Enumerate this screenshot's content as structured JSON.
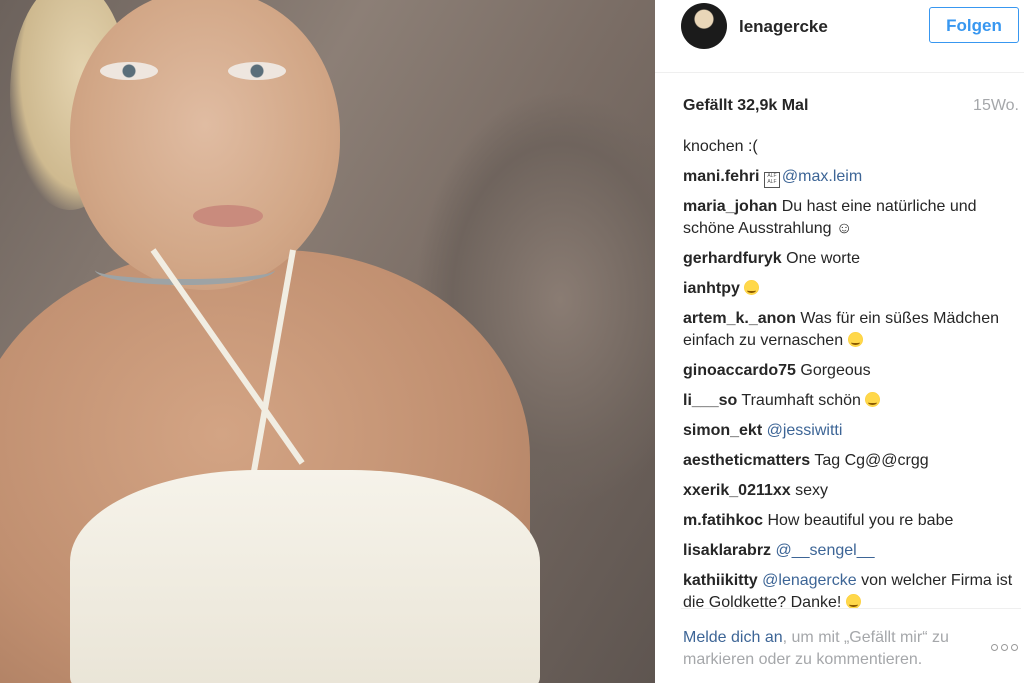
{
  "post": {
    "username": "lenagercke",
    "follow_label": "Folgen",
    "likes": "Gefällt 32,9k Mal",
    "time": "15Wo.",
    "caption": "knochen :("
  },
  "comments": [
    {
      "user": "mani.fehri",
      "text": "",
      "mention": "@max.leim",
      "tofu": "ALF ALF"
    },
    {
      "user": "maria_johan",
      "text": " Du hast eine natürliche und schöne Ausstrahlung ☺"
    },
    {
      "user": "gerhardfuryk",
      "text": " One worte"
    },
    {
      "user": "ianhtpy",
      "text": " ",
      "emoji": "heart-eyes-emoji"
    },
    {
      "user": "artem_k._anon",
      "text": " Was für ein süßes Mädchen einfach zu vernaschen ",
      "emoji": "smile-emoji"
    },
    {
      "user": "ginoaccardo75",
      "text": " Gorgeous"
    },
    {
      "user": "li___so",
      "text": " Traumhaft schön ",
      "emoji": "heart-eyes-emoji"
    },
    {
      "user": "simon_ekt",
      "text": " ",
      "mention": "@jessiwitti"
    },
    {
      "user": "aestheticmatters",
      "text": " Tag Cg@@crgg"
    },
    {
      "user": "xxerik_0211xx",
      "text": " sexy"
    },
    {
      "user": "m.fatihkoc",
      "text": " How beautiful you re babe"
    },
    {
      "user": "lisaklarabrz",
      "text": " ",
      "mention": "@__sengel__"
    },
    {
      "user": "kathiikitty",
      "text": " von welcher Firma ist die Goldkette? Danke! ",
      "mention": "@lenagercke",
      "emoji": "smile-emoji"
    }
  ],
  "login": {
    "link": "Melde dich an",
    "rest": ", um mit „Gefällt mir“ zu markieren oder zu kommentieren."
  },
  "icons": {
    "more": "more-options-icon",
    "emoji_color": "#ffd84a"
  },
  "colors": {
    "link": "#3d6596",
    "follow": "#3897f0",
    "muted": "#a5a7aa"
  }
}
